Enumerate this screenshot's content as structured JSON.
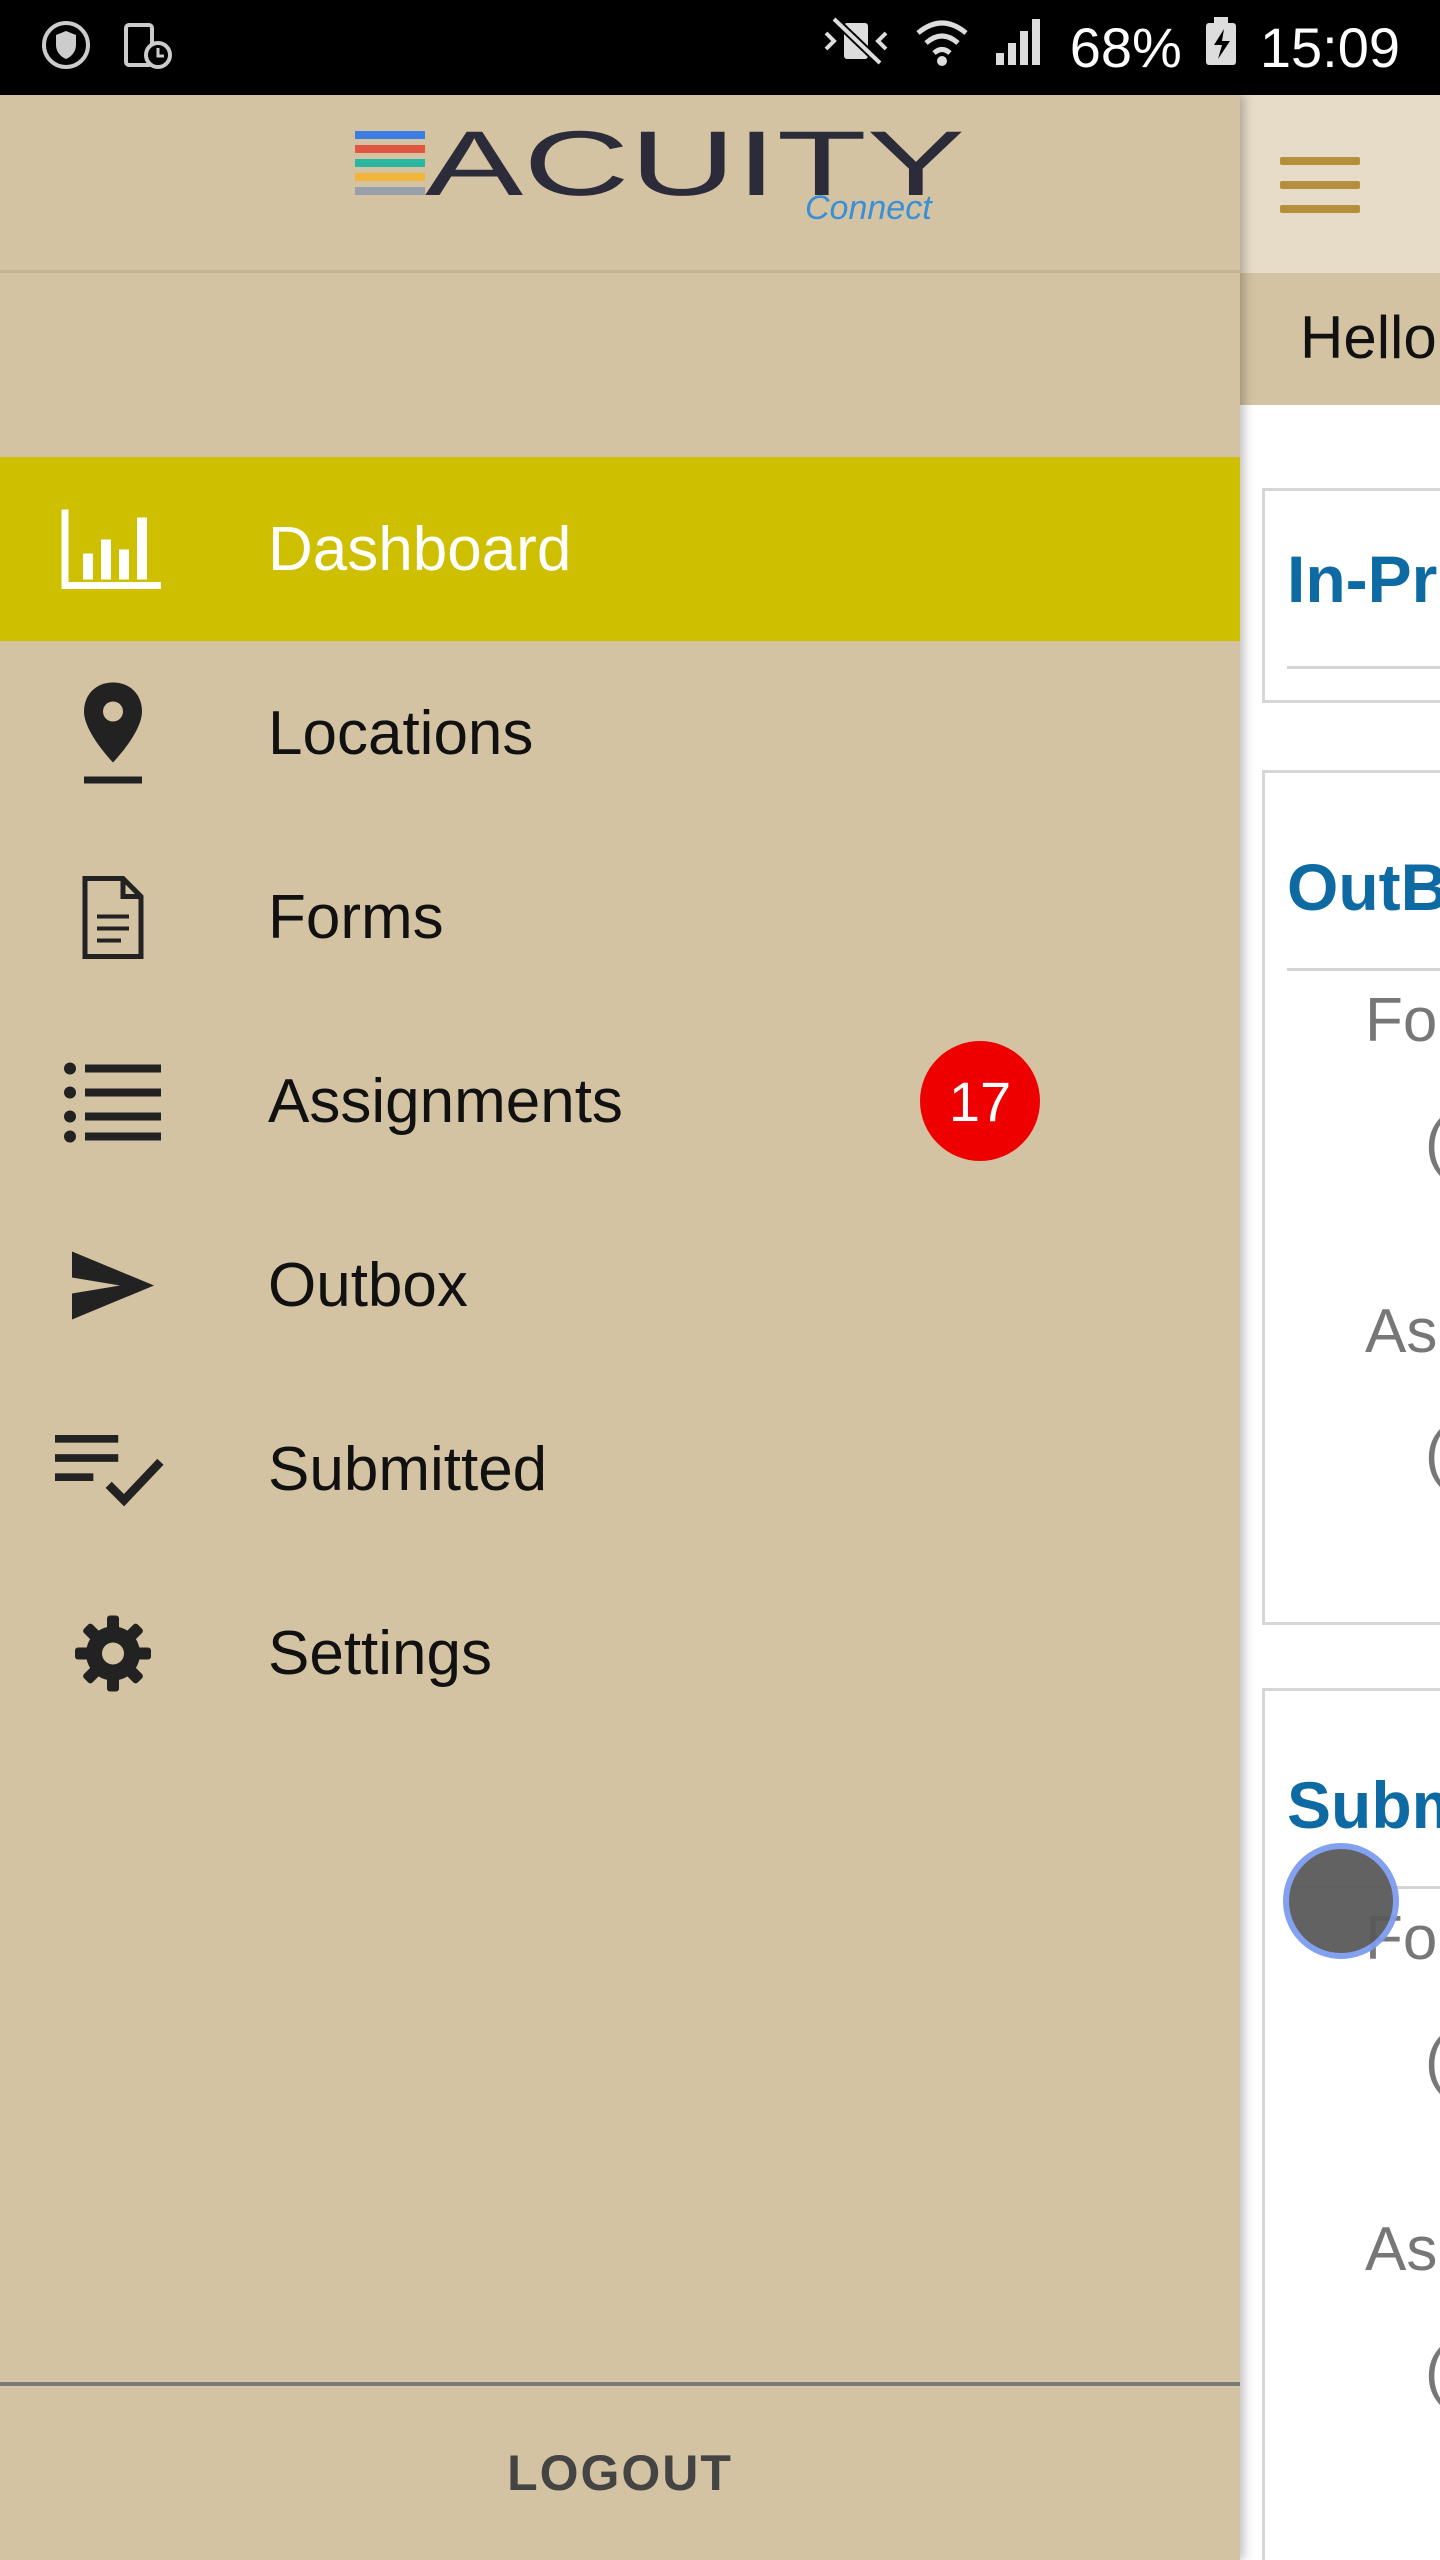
{
  "status_bar": {
    "battery_percent": "68%",
    "time": "15:09"
  },
  "logo": {
    "brand": "ACUITY",
    "sub": "Connect",
    "bar_colors": [
      "#3b7de0",
      "#e0553f",
      "#2ab7a0",
      "#f2b53a",
      "#9aa0aa"
    ]
  },
  "nav": {
    "items": [
      {
        "label": "Dashboard",
        "icon": "bar-chart-icon",
        "active": true
      },
      {
        "label": "Locations",
        "icon": "location-pin-icon"
      },
      {
        "label": "Forms",
        "icon": "document-icon"
      },
      {
        "label": "Assignments",
        "icon": "list-icon",
        "badge": "17"
      },
      {
        "label": "Outbox",
        "icon": "send-icon"
      },
      {
        "label": "Submitted",
        "icon": "checklist-icon"
      },
      {
        "label": "Settings",
        "icon": "gear-icon"
      }
    ],
    "logout_label": "LOGOUT"
  },
  "main": {
    "greeting": "Hello",
    "cards": [
      {
        "title": "In-Pr"
      },
      {
        "title": "OutB",
        "rows": [
          {
            "label": "For",
            "value": "("
          },
          {
            "label": "As",
            "value": "("
          }
        ]
      },
      {
        "title": "Subm",
        "rows": [
          {
            "label": "For",
            "value": "("
          },
          {
            "label": "As",
            "value": "("
          }
        ]
      }
    ]
  },
  "colors": {
    "drawer_bg": "#d3c3a2",
    "active_bg": "#cebf00",
    "badge": "#ee0000",
    "accent_title": "#0d6aa3"
  }
}
